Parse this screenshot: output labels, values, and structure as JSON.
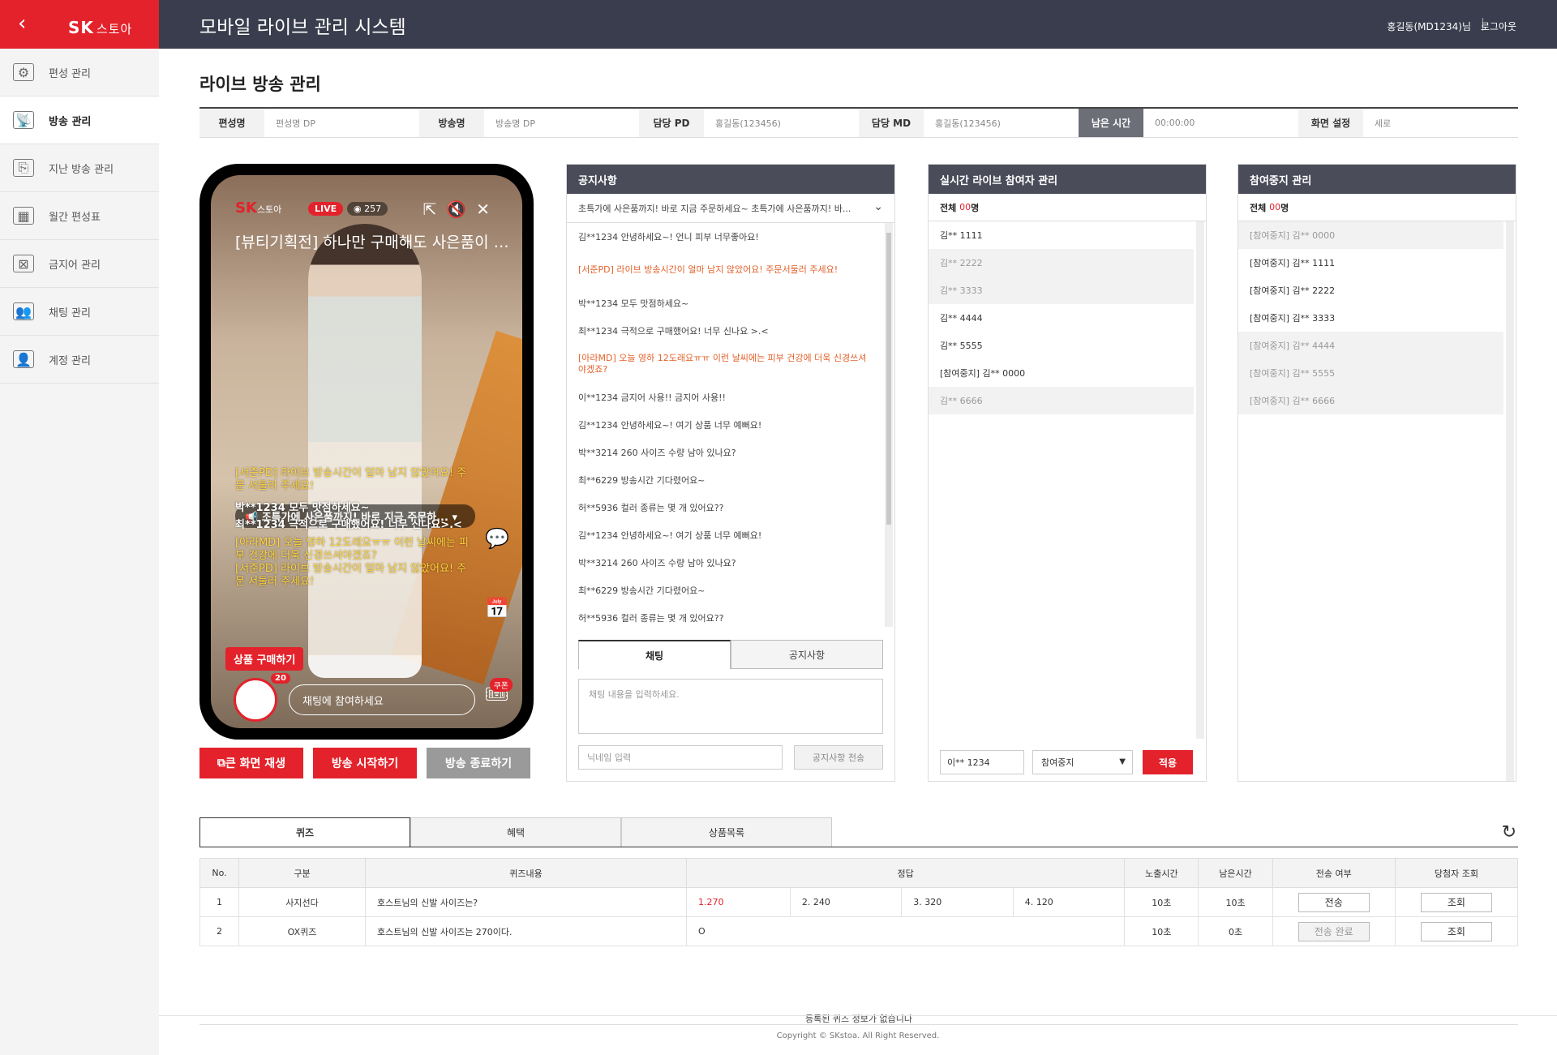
{
  "header": {
    "back_icon": "chevron-left-icon",
    "logo_sk": "SK",
    "logo_store": "스토아",
    "system_title": "모바일 라이브 관리 시스템",
    "user": "홍길동(MD1234)님",
    "logout": "로그아웃"
  },
  "sidebar": {
    "items": [
      {
        "label": "편성 관리",
        "icon": "gear-icon"
      },
      {
        "label": "방송 관리",
        "icon": "broadcast-icon"
      },
      {
        "label": "지난 방송 관리",
        "icon": "history-icon"
      },
      {
        "label": "월간 편성표",
        "icon": "calendar-icon"
      },
      {
        "label": "금지어 관리",
        "icon": "forbidden-icon"
      },
      {
        "label": "채팅 관리",
        "icon": "chat-icon"
      },
      {
        "label": "계정 관리",
        "icon": "account-icon"
      }
    ],
    "active_index": 1
  },
  "page": {
    "title": "라이브 방송 관리",
    "info": [
      {
        "label": "편성명",
        "value": "편성명 DP"
      },
      {
        "label": "방송명",
        "value": "방송명 DP"
      },
      {
        "label": "담당 PD",
        "value": "홍길동(123456)"
      },
      {
        "label": "담당 MD",
        "value": "홍길동(123456)"
      },
      {
        "label": "남은 시간",
        "value": "00:00:00"
      },
      {
        "label": "화면 설정",
        "value": "세로"
      }
    ]
  },
  "phone": {
    "logo_sk": "SK",
    "logo_store": "스토아",
    "live": "LIVE",
    "viewers": "257",
    "title": "[뷰티기획전] 하나만 구매해도 사은품이 이...",
    "notice": "조특가에 사은품까지! 바로 지금 주문하...",
    "chats": [
      {
        "text": "[서준PD] 라이브 방송시간이 얼마 남지 않았어요! 주문 서둘러 주세요!",
        "color": "y"
      },
      {
        "text": "박**1234 모두 맛점하세요~",
        "color": "w"
      },
      {
        "text": "최**1234 극적으로 구매했어요! 너무 신나요>.<",
        "color": "w"
      },
      {
        "text": "[아라MD] 오늘 영하 12도래요ㅠㅠ 이런 날씨에는 피부 건강에 더욱 신경쓰셔야겠죠?",
        "color": "y"
      },
      {
        "text": "[서준PD] 라이브 방송시간이 얼마 남지 않았어요! 주문 서둘러 주세요!",
        "color": "y"
      }
    ],
    "buy_button": "상품 구매하기",
    "avatar_count": "20",
    "chat_placeholder": "채팅에 참여하세요",
    "coupon": "쿠폰"
  },
  "buttons": {
    "big_screen": "큰 화면 재생",
    "start": "방송 시작하기",
    "end": "방송 종료하기"
  },
  "notice_panel": {
    "title": "공지사항",
    "selected_notice": "초특가에 사은품까지! 바로 지금 주문하세요~ 초특가에 사은품까지! 바...",
    "messages": [
      {
        "text": "김**1234 안녕하세요~! 언니 피부 너무좋아요!",
        "red": false
      },
      {
        "text": "[서준PD] 라이브 방송시간이 얼마 남지 않았어요! 주문서둘러 주세요!",
        "red": true
      },
      {
        "text": "박**1234 모두 맛점하세요~",
        "red": false
      },
      {
        "text": "최**1234 극적으로 구매했어요! 너무 신나요 >.<",
        "red": false
      },
      {
        "text": "[아라MD] 오늘 영하 12도래요ㅠㅠ 이런 날씨에는 피부 건강에 더욱 신경쓰셔야겠죠?",
        "red": true
      },
      {
        "text": "이**1234 금지어 사용!! 금지어 사용!!",
        "red": false
      },
      {
        "text": "김**1234 안녕하세요~! 여기 상품 너무 예뻐요!",
        "red": false
      },
      {
        "text": "박**3214 260 사이즈 수량 남아 있나요?",
        "red": false
      },
      {
        "text": "최**6229 방송시간 기다렸어요~",
        "red": false
      },
      {
        "text": "허**5936 컬러 종류는 몇 개 있어요??",
        "red": false
      },
      {
        "text": "김**1234 안녕하세요~! 여기 상품 너무 예뻐요!",
        "red": false
      },
      {
        "text": "박**3214 260 사이즈 수량 남아 있나요?",
        "red": false
      },
      {
        "text": "최**6229 방송시간 기다렸어요~",
        "red": false
      },
      {
        "text": "허**5936 컬러 종류는 몇 개 있어요??",
        "red": false
      }
    ],
    "tab_chat": "채팅",
    "tab_notice": "공지사항",
    "chat_placeholder": "채팅 내용을 입력하세요.",
    "nick_placeholder": "닉네임 입력",
    "send_notice": "공지사항 전송"
  },
  "participants_panel": {
    "title": "실시간 라이브 참여자 관리",
    "count_label": "전체",
    "count_value": "00",
    "count_unit": "명",
    "items": [
      {
        "text": "김** 1111",
        "alt": false
      },
      {
        "text": "김** 2222",
        "alt": true
      },
      {
        "text": "김** 3333",
        "alt": true
      },
      {
        "text": "김** 4444",
        "alt": false
      },
      {
        "text": "김** 5555",
        "alt": false
      },
      {
        "text": "[참여중지] 김** 0000",
        "alt": false
      },
      {
        "text": "김** 6666",
        "alt": true
      }
    ],
    "selected_user": "이** 1234",
    "action": "참여중지",
    "apply": "적용"
  },
  "blocked_panel": {
    "title": "참여중지 관리",
    "count_label": "전체",
    "count_value": "00",
    "count_unit": "명",
    "items": [
      {
        "text": "[참여중지] 김** 0000",
        "alt": true
      },
      {
        "text": "[참여중지] 김** 1111",
        "alt": false
      },
      {
        "text": "[참여중지] 김** 2222",
        "alt": false
      },
      {
        "text": "[참여중지] 김** 3333",
        "alt": false
      },
      {
        "text": "[참여중지] 김** 4444",
        "alt": true
      },
      {
        "text": "[참여중지] 김** 5555",
        "alt": true
      },
      {
        "text": "[참여중지] 김** 6666",
        "alt": true
      }
    ]
  },
  "quiz": {
    "tabs": [
      "퀴즈",
      "혜택",
      "상품목록"
    ],
    "headers": [
      "No.",
      "구분",
      "퀴즈내용",
      "정답",
      "노출시간",
      "남은시간",
      "전송 여부",
      "당첨자 조회"
    ],
    "rows": [
      {
        "no": "1",
        "type": "사지선다",
        "content": "호스트님의 신발 사이즈는?",
        "answers": [
          "1.270",
          "2. 240",
          "3. 320",
          "4. 120"
        ],
        "expose": "10초",
        "remain": "10초",
        "send": "전송",
        "send_done": false,
        "lookup": "조회"
      },
      {
        "no": "2",
        "type": "OX퀴즈",
        "content": "호스트님의 신발 사이즈는 270이다.",
        "answers": [
          "O"
        ],
        "expose": "10초",
        "remain": "0초",
        "send": "전송 완료",
        "send_done": true,
        "lookup": "조회"
      }
    ],
    "empty": "등록된 퀴즈 정보가 없습니다"
  },
  "footer": "Copyright © SKstoa. All Right Reserved."
}
